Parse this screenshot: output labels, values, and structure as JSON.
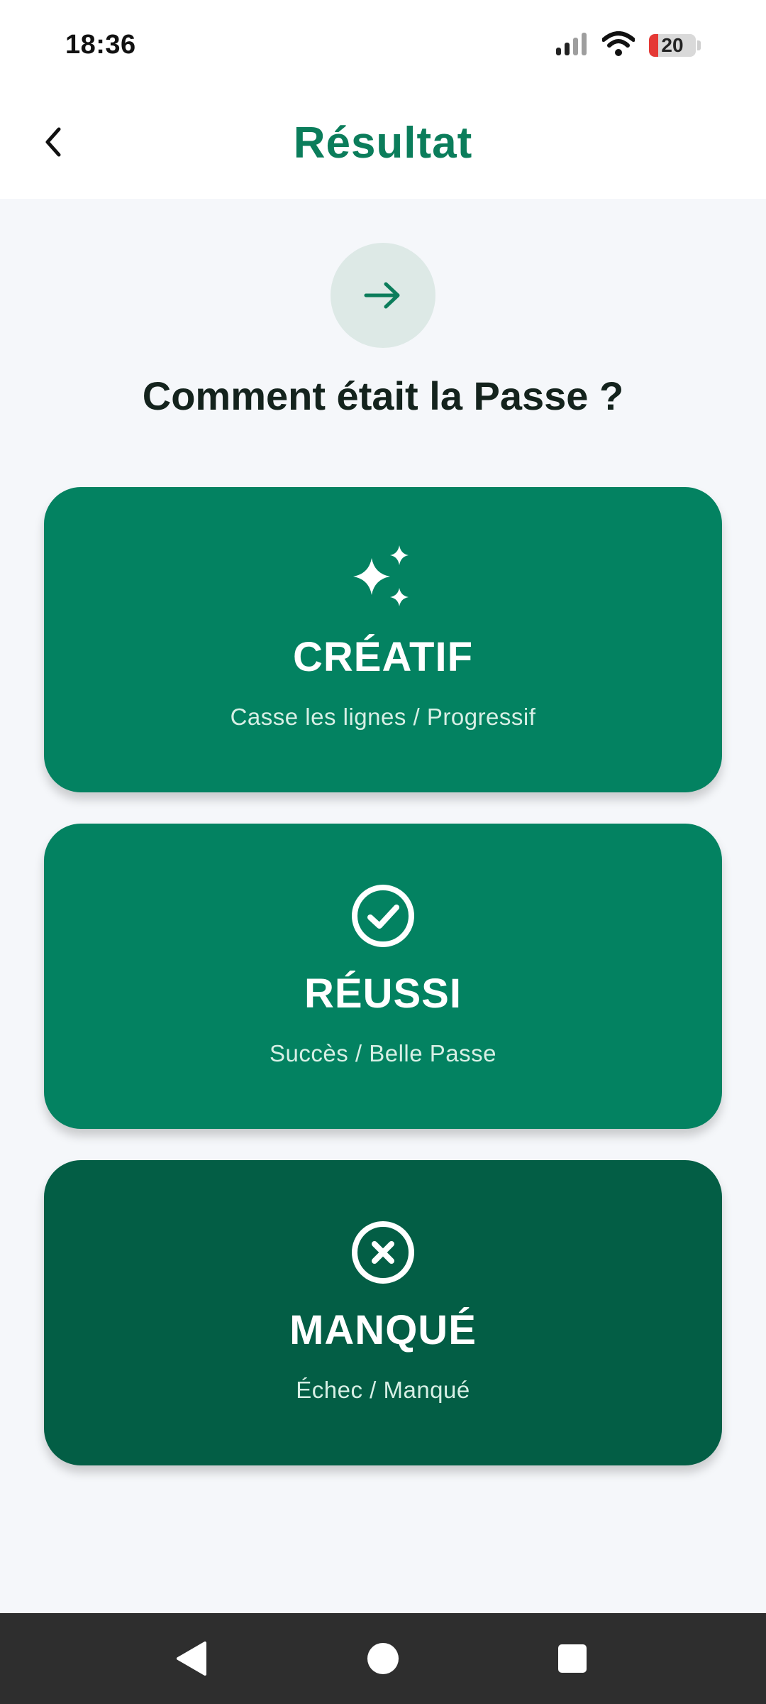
{
  "status_bar": {
    "time": "18:36",
    "battery_level": "20",
    "icons": [
      "signal-icon",
      "wifi-icon",
      "battery-icon"
    ]
  },
  "app_bar": {
    "title": "Résultat",
    "back_icon": "chevron-left-icon"
  },
  "header": {
    "icon": "arrow-right-icon",
    "question": "Comment était la Passe ?"
  },
  "options": [
    {
      "title": "CRÉATIF",
      "subtitle": "Casse les lignes / Progressif",
      "icon": "sparkles-icon",
      "color": "#038261"
    },
    {
      "title": "RÉUSSI",
      "subtitle": "Succès / Belle Passe",
      "icon": "check-circle-icon",
      "color": "#038261"
    },
    {
      "title": "MANQUÉ",
      "subtitle": "Échec / Manqué",
      "icon": "x-circle-icon",
      "color": "#035e45"
    }
  ],
  "nav_bar": {
    "icons": [
      "back-triangle-icon",
      "home-circle-icon",
      "recents-square-icon"
    ]
  },
  "colors": {
    "brand": "#0b7d5b",
    "background": "#f5f7fa",
    "nav_background": "#2e2e2e"
  }
}
